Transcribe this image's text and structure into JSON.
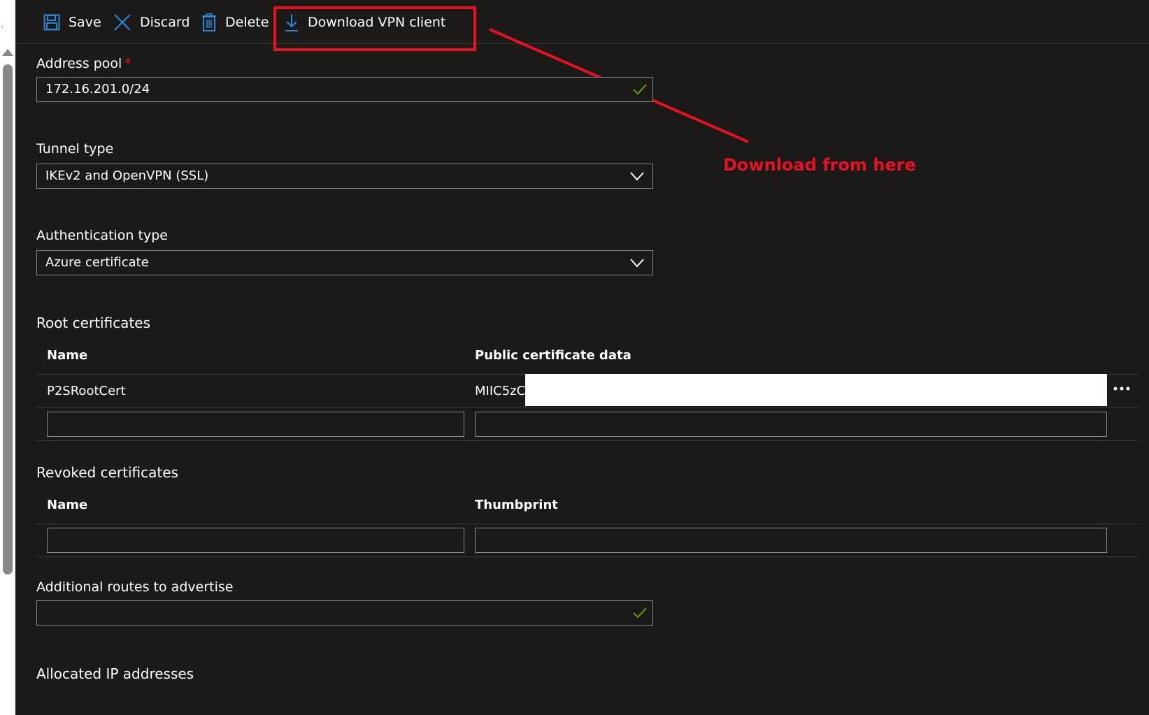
{
  "toolbar": {
    "save_label": "Save",
    "discard_label": "Discard",
    "delete_label": "Delete",
    "download_label": "Download VPN client"
  },
  "annotation": {
    "text": "Download from here",
    "color": "#e81123"
  },
  "address_pool": {
    "label": "Address pool",
    "required_mark": "*",
    "value": "172.16.201.0/24"
  },
  "tunnel_type": {
    "label": "Tunnel type",
    "value": "IKEv2 and OpenVPN (SSL)"
  },
  "auth_type": {
    "label": "Authentication type",
    "value": "Azure certificate"
  },
  "root_certificates": {
    "title": "Root certificates",
    "columns": [
      "Name",
      "Public certificate data"
    ],
    "rows": [
      {
        "name": "P2SRootCert",
        "data": "MIIC5zC"
      }
    ]
  },
  "revoked_certificates": {
    "title": "Revoked certificates",
    "columns": [
      "Name",
      "Thumbprint"
    ]
  },
  "additional_routes": {
    "label": "Additional routes to advertise",
    "value": ""
  },
  "allocated_ips": {
    "title": "Allocated IP addresses"
  },
  "colors": {
    "background": "#1b1a19",
    "accent_blue": "#2b88d8",
    "success_green": "#57a300",
    "annotation_red": "#e81123"
  }
}
